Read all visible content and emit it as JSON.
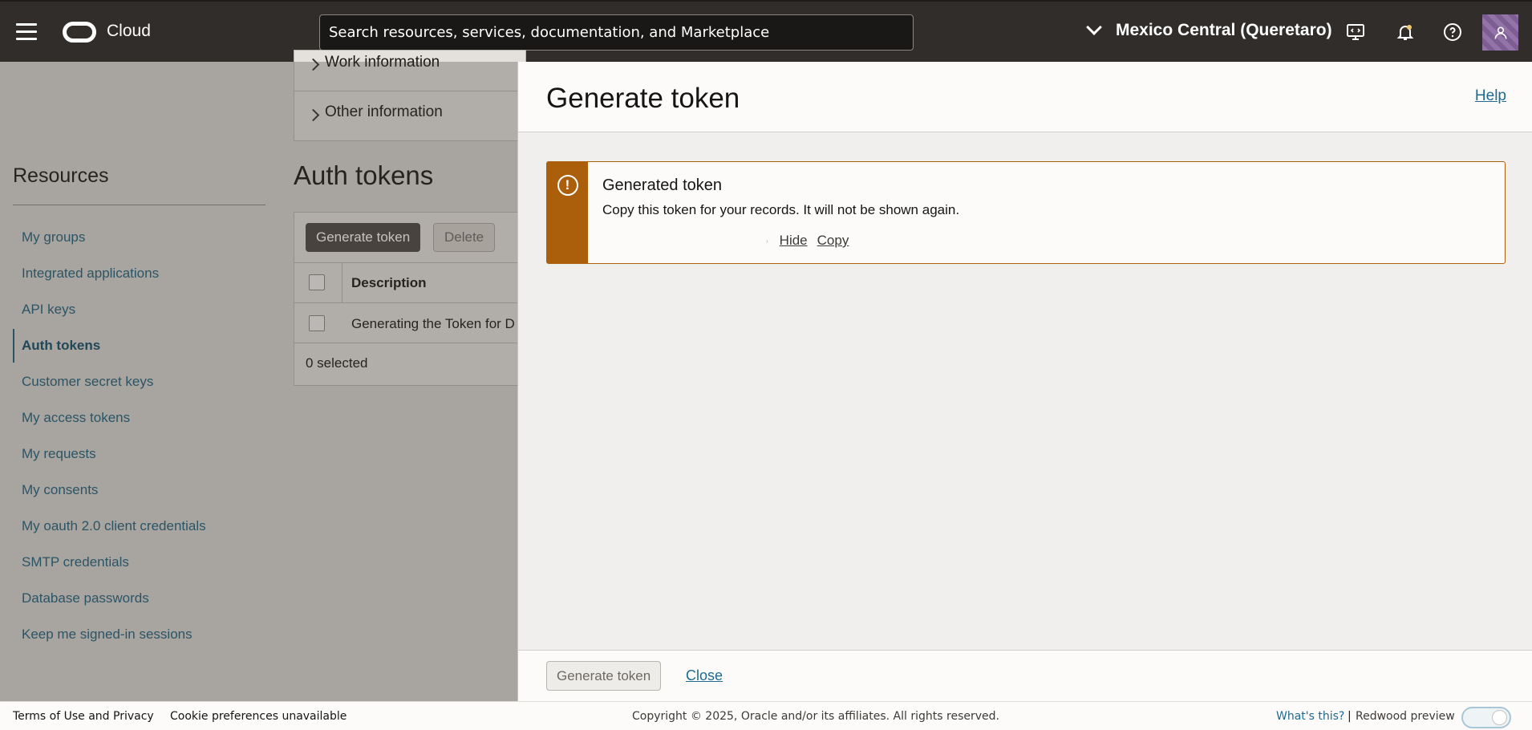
{
  "header": {
    "brand": "Cloud",
    "search_placeholder": "Search resources, services, documentation, and Marketplace",
    "region": "Mexico Central (Queretaro)"
  },
  "background": {
    "info_rows": [
      "Work information",
      "Other information"
    ],
    "resources_title": "Resources",
    "resources": [
      "My groups",
      "Integrated applications",
      "API keys",
      "Auth tokens",
      "Customer secret keys",
      "My access tokens",
      "My requests",
      "My consents",
      "My oauth 2.0 client credentials",
      "SMTP credentials",
      "Database passwords",
      "Keep me signed-in sessions"
    ],
    "active_resource": "Auth tokens",
    "auth_title": "Auth tokens",
    "generate_button": "Generate token",
    "delete_button": "Delete",
    "column_header": "Description",
    "row_description": "Generating the Token for D",
    "selected_count": "0 selected"
  },
  "drawer": {
    "title": "Generate token",
    "help_link": "Help",
    "alert": {
      "title": "Generated token",
      "message": "Copy this token for your records. It will not be shown again.",
      "hide_link": "Hide",
      "copy_link": "Copy"
    },
    "footer_generate_button": "Generate token",
    "close_link": "Close"
  },
  "footer": {
    "terms": "Terms of Use and Privacy",
    "cookies": "Cookie preferences unavailable",
    "copyright": "Copyright © 2025, Oracle and/or its affiliates. All rights reserved.",
    "whats_this": "What's this?",
    "separator": "|",
    "redwood": "Redwood preview"
  },
  "colors": {
    "topbar": "#312d2a",
    "alert_accent": "#ac5f0b",
    "link": "#1e6b8f"
  }
}
